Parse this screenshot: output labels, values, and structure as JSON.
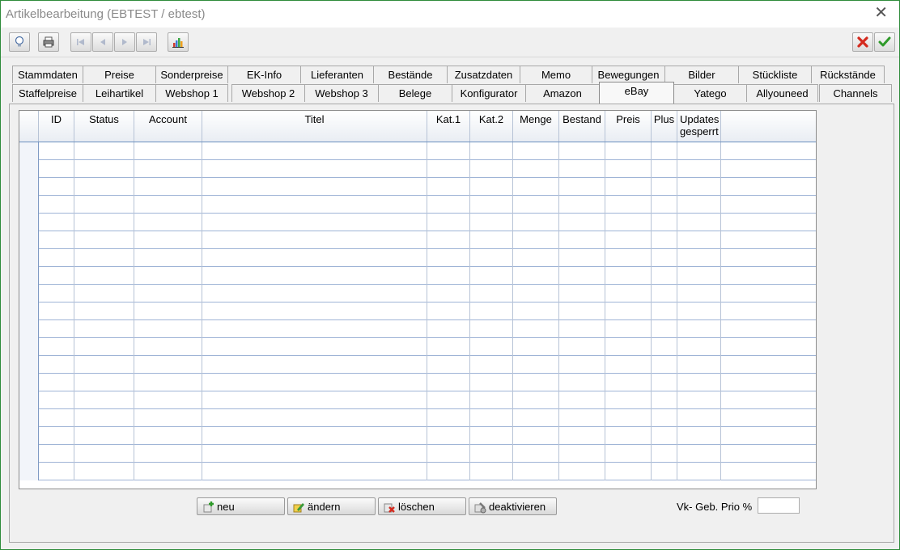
{
  "window": {
    "title": "Artikelbearbeitung (EBTEST / ebtest)",
    "close_glyph": "✕"
  },
  "toolbar": {
    "left_buttons": [
      "bulb-icon",
      "printer-icon",
      "first-record-icon",
      "prev-record-icon",
      "next-record-icon",
      "last-record-icon",
      "chart-icon"
    ],
    "right_buttons": [
      "cancel-icon",
      "ok-icon"
    ]
  },
  "tabs": {
    "row1": [
      "Stammdaten",
      "Preise",
      "Sonderpreise",
      "EK-Info",
      "Lieferanten",
      "Bestände",
      "Zusatzdaten",
      "Memo",
      "Bewegungen",
      "Bilder",
      "Stückliste",
      "Rückstände"
    ],
    "row2": [
      "Staffelpreise",
      "Leihartikel",
      "Webshop 1",
      "Webshop 2",
      "Webshop 3",
      "Belege",
      "Konfigurator",
      "Amazon",
      "eBay",
      "Yatego",
      "Allyouneed",
      "Channels"
    ],
    "active": "eBay"
  },
  "grid": {
    "columns": [
      "",
      "ID",
      "Status",
      "Account",
      "Titel",
      "Kat.1",
      "Kat.2",
      "Menge",
      "Bestand",
      "Preis",
      "Plus",
      "Updates gesperrt",
      ""
    ],
    "row_count": 19
  },
  "actions": {
    "new_label": "neu",
    "edit_label": "ändern",
    "delete_label": "löschen",
    "deactivate_label": "deaktivieren"
  },
  "vk": {
    "label": "Vk- Geb. Prio %",
    "value": ""
  }
}
